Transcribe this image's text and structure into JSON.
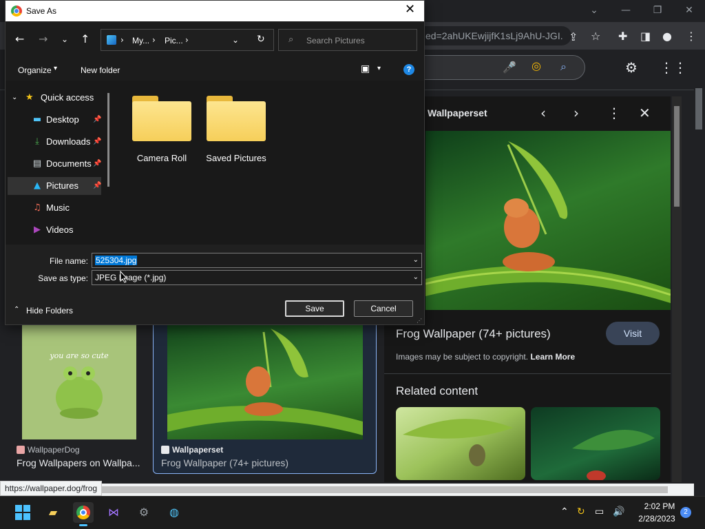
{
  "browser": {
    "url": "ed=2ahUKEwjijfK1sLj9AhU-JGI...",
    "status_url": "https://wallpaper.dog/frog"
  },
  "side_panel": {
    "source": "Wallpaperset",
    "title": "Frog Wallpaper (74+ pictures)",
    "visit_label": "Visit",
    "copyright_text": "Images may be subject to copyright.",
    "learn_more": "Learn More",
    "related_title": "Related content"
  },
  "results": [
    {
      "source": "WallpaperDog",
      "title": "Frog Wallpapers on Wallpa...",
      "image_text": "you are so cute"
    },
    {
      "source": "Wallpaperset",
      "title": "Frog Wallpaper (74+ pictures)"
    }
  ],
  "dialog": {
    "title": "Save As",
    "breadcrumb": [
      "My...",
      "Pic..."
    ],
    "search_placeholder": "Search Pictures",
    "organize_label": "Organize",
    "new_folder_label": "New folder",
    "quick_access": "Quick access",
    "nav_items": [
      {
        "label": "Desktop",
        "pinned": true
      },
      {
        "label": "Downloads",
        "pinned": true
      },
      {
        "label": "Documents",
        "pinned": true
      },
      {
        "label": "Pictures",
        "pinned": true,
        "selected": true
      },
      {
        "label": "Music",
        "pinned": false
      },
      {
        "label": "Videos",
        "pinned": false
      }
    ],
    "folders": [
      "Camera Roll",
      "Saved Pictures"
    ],
    "file_name_label": "File name:",
    "file_name_value": "525304.jpg",
    "save_type_label": "Save as type:",
    "save_type_value": "JPEG Image (*.jpg)",
    "hide_folders_label": "Hide Folders",
    "save_label": "Save",
    "cancel_label": "Cancel"
  },
  "taskbar": {
    "time": "2:02 PM",
    "date": "2/28/2023",
    "notification_count": "2"
  },
  "colors": {
    "accent": "#8ab4f8",
    "selection": "#0078d7",
    "folder": "#f6cf5a"
  }
}
